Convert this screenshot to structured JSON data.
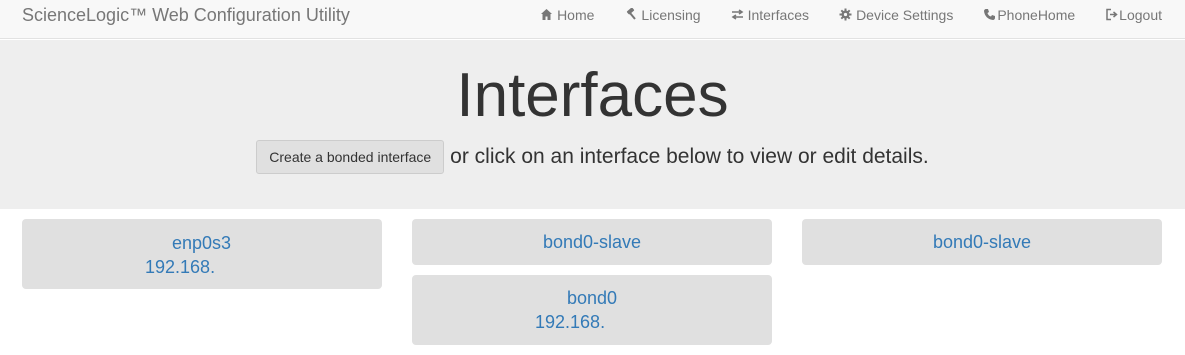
{
  "navbar": {
    "brand": "ScienceLogic™ Web Configuration Utility",
    "items": [
      {
        "label": "Home",
        "icon": "home-icon"
      },
      {
        "label": "Licensing",
        "icon": "gavel-icon"
      },
      {
        "label": "Interfaces",
        "icon": "transfer-icon"
      },
      {
        "label": "Device Settings",
        "icon": "cog-icon"
      },
      {
        "label": "PhoneHome",
        "icon": "phone-icon"
      },
      {
        "label": "Logout",
        "icon": "logout-icon"
      }
    ]
  },
  "jumbotron": {
    "title": "Interfaces",
    "button_label": "Create a bonded interface",
    "lead_text": "or click on an interface below to view or edit details."
  },
  "interfaces": [
    {
      "name": "enp0s3",
      "ip": "192.168."
    },
    {
      "name": "bond0-slave"
    },
    {
      "name": "bond0-slave"
    },
    {
      "name": "bond0",
      "ip": "192.168."
    }
  ],
  "colors": {
    "navbar_bg": "#f8f8f8",
    "jumbotron_bg": "#eeeeee",
    "card_bg": "#e0e0e0",
    "link": "#337ab7",
    "nav_text": "#777777"
  }
}
